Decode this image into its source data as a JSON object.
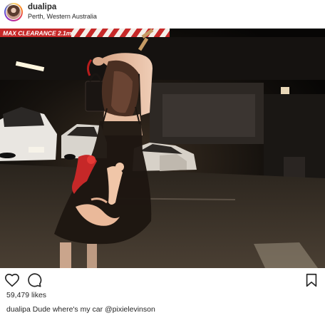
{
  "header": {
    "username": "dualipa",
    "location": "Perth, Western Australia"
  },
  "photo": {
    "sign_text": "MAX CLEARANCE 2.1m"
  },
  "actions": {
    "like_icon": "heart-icon",
    "comment_icon": "comment-icon",
    "save_icon": "bookmark-icon"
  },
  "likes": {
    "text": "59,479 likes"
  },
  "caption": {
    "username": "dualipa",
    "text": "Dude where's my car",
    "mention": "@pixielevinson"
  }
}
